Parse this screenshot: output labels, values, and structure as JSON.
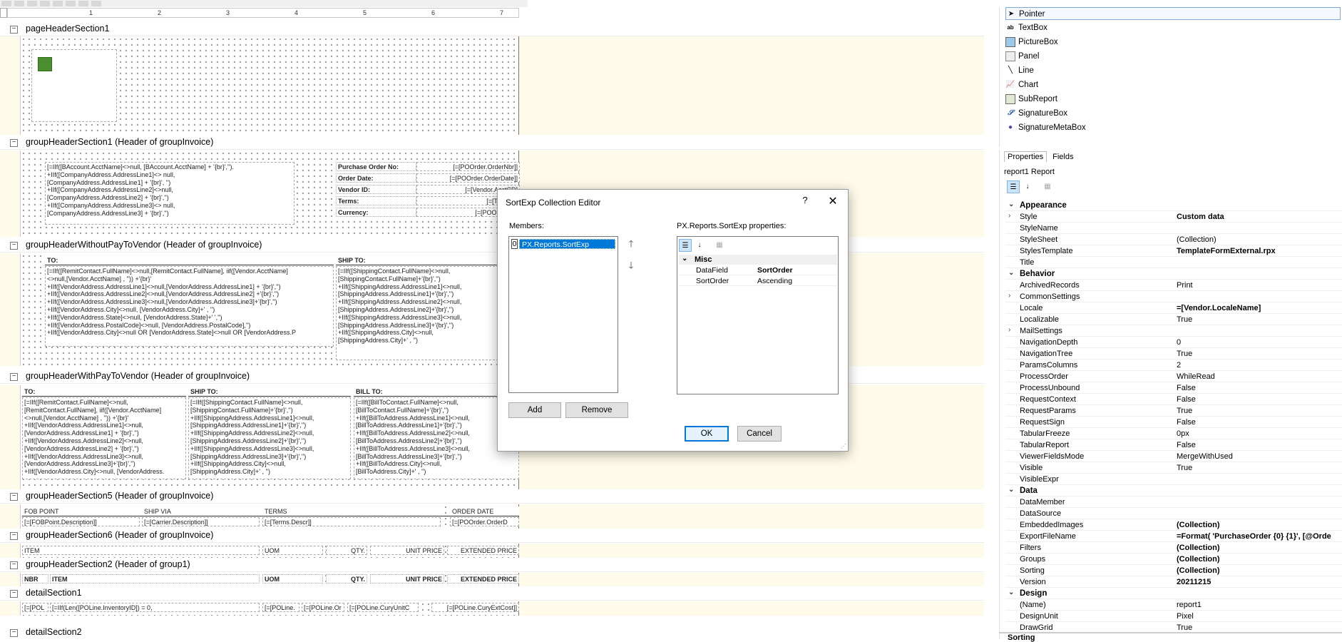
{
  "ruler": {
    "marks": [
      "1",
      "2",
      "3",
      "4",
      "5",
      "6",
      "7"
    ]
  },
  "sections": {
    "pageHeader": "pageHeaderSection1",
    "gh1": "groupHeaderSection1 (Header of groupInvoice)",
    "ghWithout": "groupHeaderWithoutPayToVendor (Header of groupInvoice)",
    "ghWith": "groupHeaderWithPayToVendor (Header of groupInvoice)",
    "gh5": "groupHeaderSection5 (Header of groupInvoice)",
    "gh6": "groupHeaderSection6 (Header of groupInvoice)",
    "gh2": "groupHeaderSection2 (Header of group1)",
    "detail1": "detailSection1",
    "detail2": "detailSection2"
  },
  "fields": {
    "gh1_left": "[=IIf([BAccount.AcctName]<>null, [BAccount.AcctName] + '{br}','').\n+IIf([CompanyAddress.AddressLine1]<> null,\n[CompanyAddress.AddressLine1] + '{br}', '')\n+IIf([CompanyAddress.AddressLine2]<>null,\n[CompanyAddress.AddressLine2] + '{br}','')\n+IIf([CompanyAddress.AddressLine3]<> null,\n[CompanyAddress.AddressLine3] + '{br}','')",
    "po_no_lbl": "Purchase Order No:",
    "po_no_val": "[=[POOrder.OrderNbr]]",
    "order_date_lbl": "Order Date:",
    "order_date_val": "[=[POOrder.OrderDate]]",
    "vendor_id_lbl": "Vendor ID:",
    "vendor_id_val": "[=[Vendor.AcctCD]",
    "terms_lbl": "Terms:",
    "terms_val": "[=[Terms.D",
    "currency_lbl": "Currency:",
    "currency_val": "[=[POOrder.Cu",
    "to_lbl": "TO:",
    "shipto_lbl": "SHIP TO:",
    "wo_to": "[=IIf([RemitContact.FullName]<>null,[RemitContact.FullName], iif([Vendor.AcctName]\n<>null,[Vendor.AcctName] , '')) +'{br}'\n+IIf([VendorAddress.AddressLine1]<>null,[VendorAddress.AddressLine1] + '{br}','')\n+IIf([VendorAddress.AddressLine2]<>null,[VendorAddress.AddressLine2] +'{br}','')\n+IIf([VendorAddress.AddressLine3]<>null,[VendorAddress.AddressLine3]+'{br}','')\n+IIf([VendorAddress.City]<>null, [VendorAddress.City]+' , '')\n+IIf([VendorAddress.State]<>null, [VendorAddress.State]+' ','')\n+IIf([VendorAddress.PostalCode]<>null, [VendorAddress.PostalCode],'')\n+IIf([VendorAddress.City]<>null OR [VendorAddress.State]<>null OR [VendorAddress.P",
    "wo_ship": "[=IIf([ShippingContact.FullName]<>null,\n[ShippingContact.FullName]+'{br}','')\n+IIf([ShippingAddress.AddressLine1]<>null,\n[ShippingAddress.AddressLine1]+'{br}','')\n+IIf([ShippingAddress.AddressLine2]<>null,\n[ShippingAddress.AddressLine2]+'{br}','')\n+IIf([ShippingAddress.AddressLine3]<>null,\n[ShippingAddress.AddressLine3]+'{br}','')\n+IIf([ShippingAddress.City]<>null,\n[ShippingAddress.City]+' , '')",
    "billto_lbl": "BILL TO:",
    "w_to": "[=IIf([RemitContact.FullName]<>null,\n[RemitContact.FullName], iif([Vendor.AcctName]\n<>null,[Vendor.AcctName] , '')) +'{br}'\n+IIf([VendorAddress.AddressLine1]<>null,\n[VendorAddress.AddressLine1] + '{br}','')\n+IIf([VendorAddress.AddressLine2]<>null,\n[VendorAddress.AddressLine2] + '{br}','')\n+IIf([VendorAddress.AddressLine3]<>null,\n[VendorAddress.AddressLine3]+'{br}','')\n+IIf([VendorAddress.City]<>null, [VendorAddress.",
    "w_ship": "[=IIf([ShippingContact.FullName]<>null,\n[ShippingContact.FullName]+'{br}','')\n+IIf([ShippingAddress.AddressLine1]<>null,\n[ShippingAddress.AddressLine1]+'{br}','')\n+IIf([ShippingAddress.AddressLine2]<>null,\n[ShippingAddress.AddressLine2]+'{br}','')\n+IIf([ShippingAddress.AddressLine3]<>null,\n[ShippingAddress.AddressLine3]+'{br}','')\n+IIf([ShippingAddress.City]<>null,\n[ShippingAddress.City]+' , '')",
    "w_bill": "[=IIf([BillToContact.FullName]<>null,\n[BillToContact.FullName]+'{br}','')\n+IIf([BillToAddress.AddressLine1]<>null,\n[BillToAddress.AddressLine1]+'{br}','')\n+IIf([BillToAddress.AddressLine2]<>null,\n[BillToAddress.AddressLine2]+'{br}','')\n+IIf([BillToAddress.AddressLine3]<>null,\n[BillToAddress.AddressLine3]+'{br}','')\n+IIf([BillToAddress.City]<>null,\n[BillToAddress.City]+' , '')",
    "fob_lbl": "FOB POINT",
    "shipvia_lbl": "SHIP VIA",
    "terms2_lbl": "TERMS",
    "orderdate2_lbl": "ORDER DATE",
    "fob_val": "[=[FOBPoint.Description]]",
    "carrier_val": "[=[Carrier.Description]]",
    "terms_descr": "[=[Terms.Descr]]",
    "orderdate2_val": "[=[POOrder.OrderD",
    "item_lbl": "ITEM",
    "uom_lbl": "UOM",
    "qty_lbl": "QTY.",
    "unitprice_lbl": "UNIT PRICE",
    "extprice_lbl": "EXTENDED PRICE",
    "nbr_lbl": "NBR",
    "d_pol": "[=[POL",
    "d_inv": "[=IIf(Len([POLine.InventoryID]) = 0,",
    "d_pol2": "[=[POLine.",
    "d_pol3": "[=[POLine.Or",
    "d_cury": "[=[POLine.CuryUnitC",
    "d_ext": "[=[POLine.CuryExtCost]]"
  },
  "dialog": {
    "title": "SortExp Collection Editor",
    "help": "?",
    "close": "✕",
    "members_label": "Members:",
    "props_label": "PX.Reports.SortExp properties:",
    "member_index": "0",
    "member_name": "PX.Reports.SortExp",
    "add": "Add",
    "remove": "Remove",
    "ok": "OK",
    "cancel": "Cancel",
    "category": "Misc",
    "rows": [
      {
        "k": "DataField",
        "v": "SortOrder"
      },
      {
        "k": "SortOrder",
        "v": "Ascending"
      }
    ]
  },
  "toolbox": {
    "items": [
      {
        "label": "Pointer",
        "icon": "pointer-icon"
      },
      {
        "label": "TextBox",
        "icon": "textbox-icon"
      },
      {
        "label": "PictureBox",
        "icon": "picturebox-icon"
      },
      {
        "label": "Panel",
        "icon": "panel-icon"
      },
      {
        "label": "Line",
        "icon": "line-icon"
      },
      {
        "label": "Chart",
        "icon": "chart-icon"
      },
      {
        "label": "SubReport",
        "icon": "subreport-icon"
      },
      {
        "label": "SignatureBox",
        "icon": "signaturebox-icon"
      },
      {
        "label": "SignatureMetaBox",
        "icon": "signaturemetabox-icon"
      }
    ]
  },
  "propgrid": {
    "tab_properties": "Properties",
    "tab_fields": "Fields",
    "object": "report1 Report",
    "rows": [
      {
        "t": "cat",
        "k": "Appearance"
      },
      {
        "k": "Style",
        "v": "Custom data",
        "b": true,
        "exp": true
      },
      {
        "k": "StyleName",
        "v": ""
      },
      {
        "k": "StyleSheet",
        "v": "(Collection)"
      },
      {
        "k": "StylesTemplate",
        "v": "TemplateFormExternal.rpx",
        "b": true
      },
      {
        "k": "Title",
        "v": ""
      },
      {
        "t": "cat",
        "k": "Behavior"
      },
      {
        "k": "ArchivedRecords",
        "v": "Print"
      },
      {
        "k": "CommonSettings",
        "v": "",
        "exp": true
      },
      {
        "k": "Locale",
        "v": "=[Vendor.LocaleName]",
        "b": true
      },
      {
        "k": "Localizable",
        "v": "True"
      },
      {
        "k": "MailSettings",
        "v": "",
        "exp": true
      },
      {
        "k": "NavigationDepth",
        "v": "0"
      },
      {
        "k": "NavigationTree",
        "v": "True"
      },
      {
        "k": "ParamsColumns",
        "v": "2"
      },
      {
        "k": "ProcessOrder",
        "v": "WhileRead"
      },
      {
        "k": "ProcessUnbound",
        "v": "False"
      },
      {
        "k": "RequestContext",
        "v": "False"
      },
      {
        "k": "RequestParams",
        "v": "True"
      },
      {
        "k": "RequestSign",
        "v": "False"
      },
      {
        "k": "TabularFreeze",
        "v": "0px"
      },
      {
        "k": "TabularReport",
        "v": "False"
      },
      {
        "k": "ViewerFieldsMode",
        "v": "MergeWithUsed"
      },
      {
        "k": "Visible",
        "v": "True"
      },
      {
        "k": "VisibleExpr",
        "v": ""
      },
      {
        "t": "cat",
        "k": "Data"
      },
      {
        "k": "DataMember",
        "v": ""
      },
      {
        "k": "DataSource",
        "v": ""
      },
      {
        "k": "EmbeddedImages",
        "v": "(Collection)",
        "b": true
      },
      {
        "k": "ExportFileName",
        "v": "=Format( 'PurchaseOrder {0} {1}', [@Orde",
        "b": true
      },
      {
        "k": "Filters",
        "v": "(Collection)",
        "b": true
      },
      {
        "k": "Groups",
        "v": "(Collection)",
        "b": true
      },
      {
        "k": "Sorting",
        "v": "(Collection)",
        "b": true
      },
      {
        "k": "Version",
        "v": "20211215",
        "b": true
      },
      {
        "t": "cat",
        "k": "Design"
      },
      {
        "k": "(Name)",
        "v": "report1"
      },
      {
        "k": "DesignUnit",
        "v": "Pixel"
      },
      {
        "k": "DrawGrid",
        "v": "True"
      }
    ],
    "bottom": "Sorting"
  }
}
